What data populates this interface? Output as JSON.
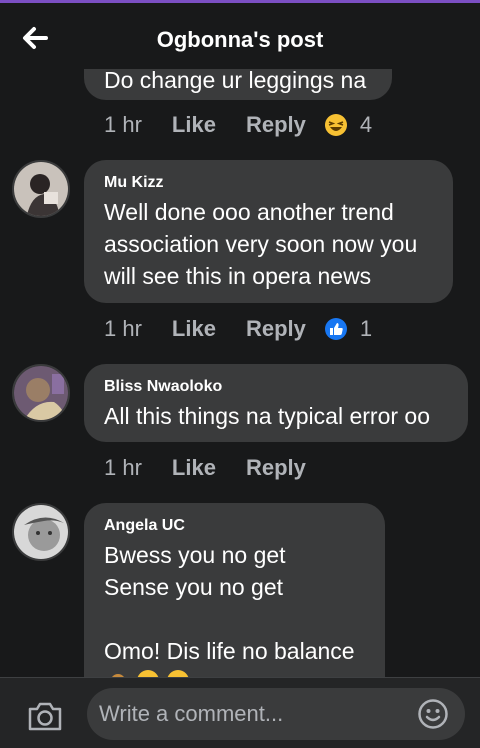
{
  "header": {
    "title": "Ogbonna's post"
  },
  "comments": [
    {
      "name": "",
      "text": "Do change ur leggings na",
      "time": "1 hr",
      "like": "Like",
      "reply": "Reply",
      "reaction_icon": "laughing-emoji-icon",
      "reaction_count": "4"
    },
    {
      "name": "Mu Kizz",
      "text": "Well done ooo another trend association very soon now you will see this in opera news",
      "time": "1 hr",
      "like": "Like",
      "reply": "Reply",
      "reaction_icon": "like-thumb-icon",
      "reaction_count": "1"
    },
    {
      "name": "Bliss Nwaoloko",
      "text": "All this things na typical error oo",
      "time": "1 hr",
      "like": "Like",
      "reply": "Reply"
    },
    {
      "name": "Angela UC",
      "text": "Bwess you no get\nSense you no get\n\nOmo! Dis life no balance"
    }
  ],
  "composer": {
    "placeholder": "Write a comment..."
  },
  "colors": {
    "background": "#18191a",
    "bubble": "#3a3b3c",
    "accent": "#7b4fc3",
    "like_blue": "#1877f2"
  }
}
